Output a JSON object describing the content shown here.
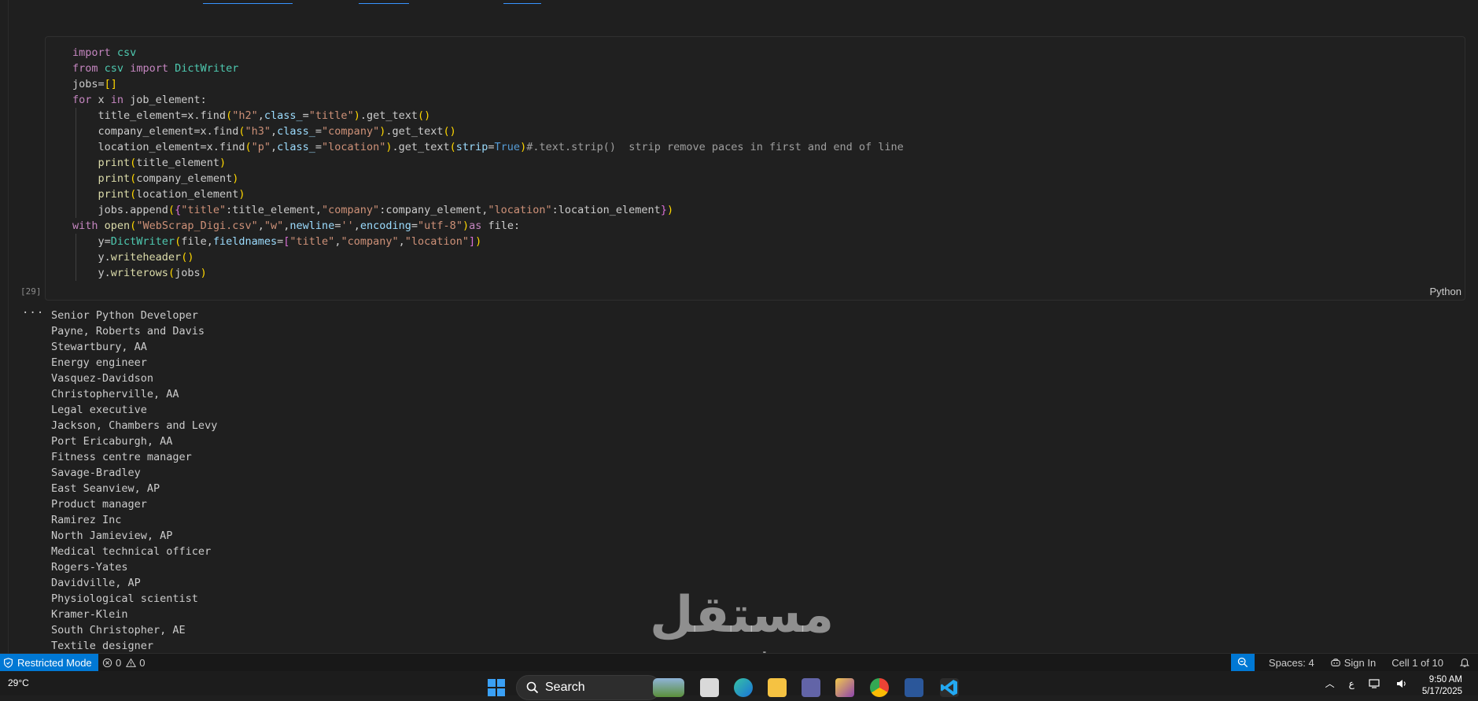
{
  "cell": {
    "exec_count": "[29]",
    "language": "Python",
    "lines": [
      [
        {
          "t": "import",
          "c": "kw"
        },
        {
          "t": " "
        },
        {
          "t": "csv",
          "c": "mod"
        }
      ],
      [
        {
          "t": "from",
          "c": "kw"
        },
        {
          "t": " "
        },
        {
          "t": "csv",
          "c": "mod"
        },
        {
          "t": " "
        },
        {
          "t": "import",
          "c": "kw"
        },
        {
          "t": " "
        },
        {
          "t": "DictWriter",
          "c": "mod"
        }
      ],
      [
        {
          "t": "jobs="
        },
        {
          "t": "[]",
          "c": "br1"
        }
      ],
      [
        {
          "t": "for",
          "c": "kw"
        },
        {
          "t": " x "
        },
        {
          "t": "in",
          "c": "kw"
        },
        {
          "t": " job_element:"
        }
      ],
      [
        {
          "t": "    title_element=x.find"
        },
        {
          "t": "(",
          "c": "br1"
        },
        {
          "t": "\"h2\"",
          "c": "str"
        },
        {
          "t": ","
        },
        {
          "t": "class_",
          "c": "param"
        },
        {
          "t": "="
        },
        {
          "t": "\"title\"",
          "c": "str"
        },
        {
          "t": ")",
          "c": "br1"
        },
        {
          "t": ".get_text"
        },
        {
          "t": "()",
          "c": "br1"
        }
      ],
      [
        {
          "t": "    company_element=x.find"
        },
        {
          "t": "(",
          "c": "br1"
        },
        {
          "t": "\"h3\"",
          "c": "str"
        },
        {
          "t": ","
        },
        {
          "t": "class_",
          "c": "param"
        },
        {
          "t": "="
        },
        {
          "t": "\"company\"",
          "c": "str"
        },
        {
          "t": ")",
          "c": "br1"
        },
        {
          "t": ".get_text"
        },
        {
          "t": "()",
          "c": "br1"
        }
      ],
      [
        {
          "t": "    location_element=x.find"
        },
        {
          "t": "(",
          "c": "br1"
        },
        {
          "t": "\"p\"",
          "c": "str"
        },
        {
          "t": ","
        },
        {
          "t": "class_",
          "c": "param"
        },
        {
          "t": "="
        },
        {
          "t": "\"location\"",
          "c": "str"
        },
        {
          "t": ")",
          "c": "br1"
        },
        {
          "t": ".get_text"
        },
        {
          "t": "(",
          "c": "br1"
        },
        {
          "t": "strip",
          "c": "param"
        },
        {
          "t": "="
        },
        {
          "t": "True",
          "c": "true"
        },
        {
          "t": ")",
          "c": "br1"
        },
        {
          "t": "#.text.strip()  strip remove paces in first and end of line",
          "c": "cmt"
        }
      ],
      [
        {
          "t": "    "
        },
        {
          "t": "print",
          "c": "fn"
        },
        {
          "t": "(",
          "c": "br1"
        },
        {
          "t": "title_element"
        },
        {
          "t": ")",
          "c": "br1"
        }
      ],
      [
        {
          "t": "    "
        },
        {
          "t": "print",
          "c": "fn"
        },
        {
          "t": "(",
          "c": "br1"
        },
        {
          "t": "company_element"
        },
        {
          "t": ")",
          "c": "br1"
        }
      ],
      [
        {
          "t": "    "
        },
        {
          "t": "print",
          "c": "fn"
        },
        {
          "t": "(",
          "c": "br1"
        },
        {
          "t": "location_element"
        },
        {
          "t": ")",
          "c": "br1"
        }
      ],
      [
        {
          "t": "    jobs.append"
        },
        {
          "t": "(",
          "c": "br1"
        },
        {
          "t": "{",
          "c": "br2"
        },
        {
          "t": "\"title\"",
          "c": "str"
        },
        {
          "t": ":title_element,"
        },
        {
          "t": "\"company\"",
          "c": "str"
        },
        {
          "t": ":company_element,"
        },
        {
          "t": "\"location\"",
          "c": "str"
        },
        {
          "t": ":location_element"
        },
        {
          "t": "}",
          "c": "br2"
        },
        {
          "t": ")",
          "c": "br1"
        }
      ],
      [
        {
          "t": "with",
          "c": "kw"
        },
        {
          "t": " "
        },
        {
          "t": "open",
          "c": "fn"
        },
        {
          "t": "(",
          "c": "br1"
        },
        {
          "t": "\"WebScrap_Digi.csv\"",
          "c": "str"
        },
        {
          "t": ","
        },
        {
          "t": "\"w\"",
          "c": "str"
        },
        {
          "t": ","
        },
        {
          "t": "newline",
          "c": "param"
        },
        {
          "t": "="
        },
        {
          "t": "''",
          "c": "str"
        },
        {
          "t": ","
        },
        {
          "t": "encoding",
          "c": "param"
        },
        {
          "t": "="
        },
        {
          "t": "\"utf-8\"",
          "c": "str"
        },
        {
          "t": ")",
          "c": "br1"
        },
        {
          "t": "as",
          "c": "kw"
        },
        {
          "t": " file:"
        }
      ],
      [
        {
          "t": "    y="
        },
        {
          "t": "DictWriter",
          "c": "mod"
        },
        {
          "t": "(",
          "c": "br1"
        },
        {
          "t": "file,"
        },
        {
          "t": "fieldnames",
          "c": "param"
        },
        {
          "t": "="
        },
        {
          "t": "[",
          "c": "br2"
        },
        {
          "t": "\"title\"",
          "c": "str"
        },
        {
          "t": ","
        },
        {
          "t": "\"company\"",
          "c": "str"
        },
        {
          "t": ","
        },
        {
          "t": "\"location\"",
          "c": "str"
        },
        {
          "t": "]",
          "c": "br2"
        },
        {
          "t": ")",
          "c": "br1"
        }
      ],
      [
        {
          "t": "    y."
        },
        {
          "t": "writeheader",
          "c": "fn"
        },
        {
          "t": "()",
          "c": "br1"
        }
      ],
      [
        {
          "t": "    y."
        },
        {
          "t": "writerows",
          "c": "fn"
        },
        {
          "t": "(",
          "c": "br1"
        },
        {
          "t": "jobs"
        },
        {
          "t": ")",
          "c": "br1"
        }
      ]
    ]
  },
  "output": {
    "more_label": "···",
    "lines": [
      "Senior Python Developer",
      "Payne, Roberts and Davis",
      "Stewartbury, AA",
      "Energy engineer",
      "Vasquez-Davidson",
      "Christopherville, AA",
      "Legal executive",
      "Jackson, Chambers and Levy",
      "Port Ericaburgh, AA",
      "Fitness centre manager",
      "Savage-Bradley",
      "East Seanview, AP",
      "Product manager",
      "Ramirez Inc",
      "North Jamieview, AP",
      "Medical technical officer",
      "Rogers-Yates",
      "Davidville, AP",
      "Physiological scientist",
      "Kramer-Klein",
      "South Christopher, AE",
      "Textile designer"
    ]
  },
  "watermark": {
    "arabic": "مستقل",
    "latin": "mostaql.com"
  },
  "statusbar": {
    "restricted_mode": "Restricted Mode",
    "errors": "0",
    "warnings": "0",
    "spaces": "Spaces: 4",
    "sign_in": "Sign In",
    "cell_pos": "Cell 1 of 10"
  },
  "taskbar": {
    "weather": "29°C",
    "search_label": "Search",
    "ime": "ع",
    "time": "9:50 AM",
    "date": "5/17/2025"
  },
  "colors": {
    "accent": "#0078d4",
    "editor_bg": "#1f1f1f"
  }
}
